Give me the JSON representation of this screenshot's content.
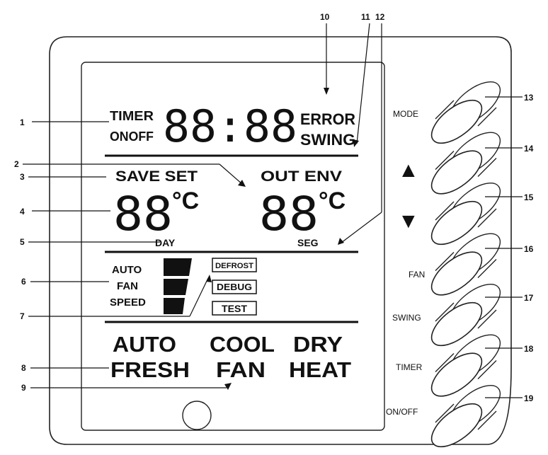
{
  "display": {
    "timer": "TIMER",
    "onoff": "ONOFF",
    "clock": "88:88",
    "error": "ERROR",
    "swing": "SWING",
    "save_set": "SAVE SET",
    "out_env": "OUT ENV",
    "temp_left": "88",
    "temp_right": "88",
    "unit": "°C",
    "day": "DAY",
    "seg": "SEG",
    "fan_auto": "AUTO",
    "fan_fan": "FAN",
    "fan_speed": "SPEED",
    "defrost": "DEFROST",
    "debug": "DEBUG",
    "test": "TEST",
    "mode_auto": "AUTO",
    "mode_cool": "COOL",
    "mode_dry": "DRY",
    "mode_fresh": "FRESH",
    "mode_fan": "FAN",
    "mode_heat": "HEAT"
  },
  "buttons": {
    "mode": "MODE",
    "up": "▲",
    "down": "▼",
    "fan": "FAN",
    "swing": "SWING",
    "timer": "TIMER",
    "onoff": "ON/OFF"
  },
  "callouts": [
    "1",
    "2",
    "3",
    "4",
    "5",
    "6",
    "7",
    "8",
    "9",
    "10",
    "11",
    "12",
    "13",
    "14",
    "15",
    "16",
    "17",
    "18",
    "19"
  ]
}
